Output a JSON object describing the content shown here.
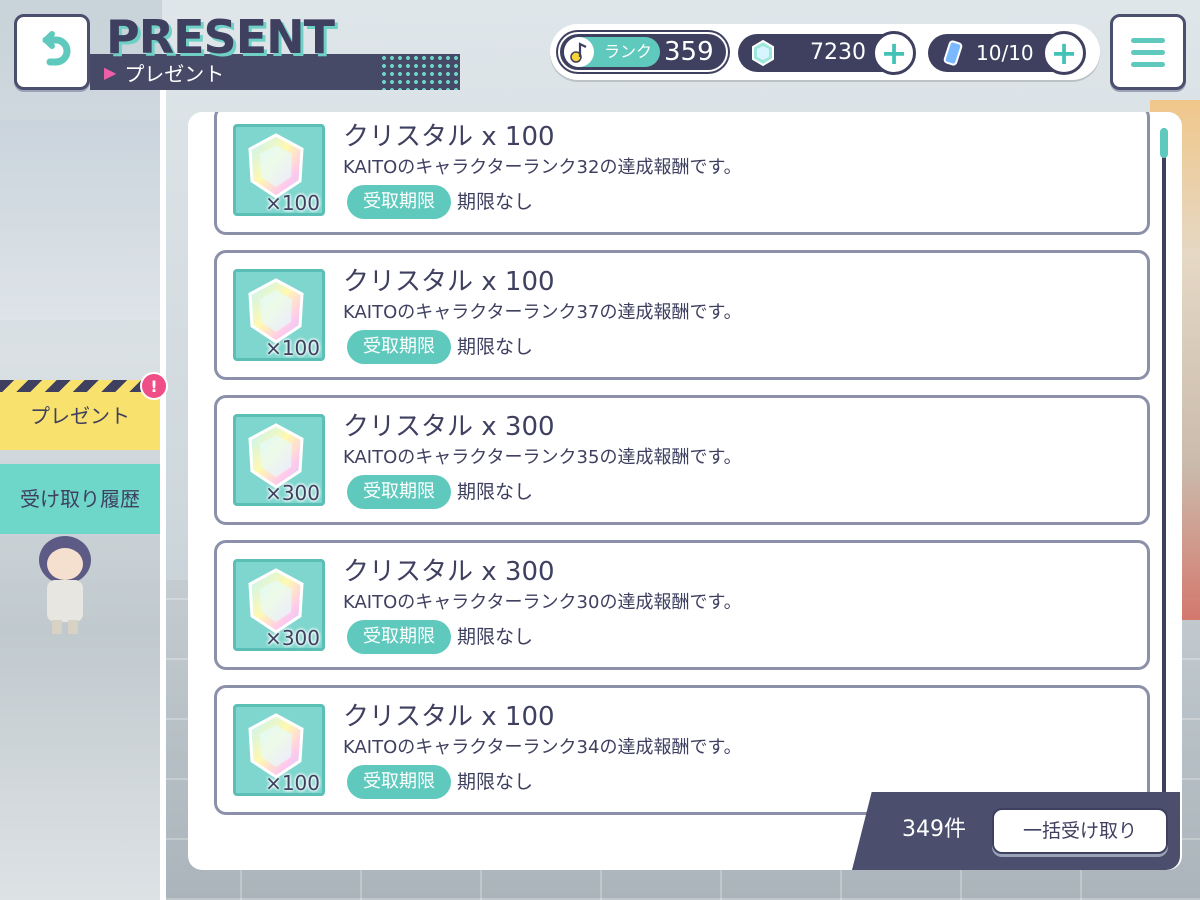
{
  "header": {
    "title_en": "PRESENT",
    "title_ja": "プレゼント"
  },
  "status": {
    "rank_label": "ランク",
    "rank_value": "359",
    "crystal_value": "7230",
    "energy_value": "10/10"
  },
  "sidebar": {
    "tabs": [
      {
        "label": "プレゼント",
        "selected": true,
        "badge": "!"
      },
      {
        "label": "受け取り履歴",
        "selected": false
      }
    ]
  },
  "presents": {
    "items": [
      {
        "name": "クリスタル x 100",
        "desc": "KAITOのキャラクターランク32の達成報酬です。",
        "qty": "×100",
        "tag": "受取期限",
        "limit": "期限なし"
      },
      {
        "name": "クリスタル x 100",
        "desc": "KAITOのキャラクターランク37の達成報酬です。",
        "qty": "×100",
        "tag": "受取期限",
        "limit": "期限なし"
      },
      {
        "name": "クリスタル x 300",
        "desc": "KAITOのキャラクターランク35の達成報酬です。",
        "qty": "×300",
        "tag": "受取期限",
        "limit": "期限なし"
      },
      {
        "name": "クリスタル x 300",
        "desc": "KAITOのキャラクターランク30の達成報酬です。",
        "qty": "×300",
        "tag": "受取期限",
        "limit": "期限なし"
      },
      {
        "name": "クリスタル x 100",
        "desc": "KAITOのキャラクターランク34の達成報酬です。",
        "qty": "×100",
        "tag": "受取期限",
        "limit": "期限なし"
      }
    ]
  },
  "footer": {
    "count": "349件",
    "receive_all_label": "一括受け取り"
  },
  "icons": {
    "back": "back-arrow-icon",
    "menu": "hamburger-menu-icon",
    "rank": "music-note-icon",
    "crystal": "crystal-icon",
    "energy": "energy-bottle-icon"
  },
  "colors": {
    "accent": "#5fc9bd",
    "navy": "#3f4060",
    "present_tab": "#f8e16c",
    "badge": "#ef4f86"
  }
}
